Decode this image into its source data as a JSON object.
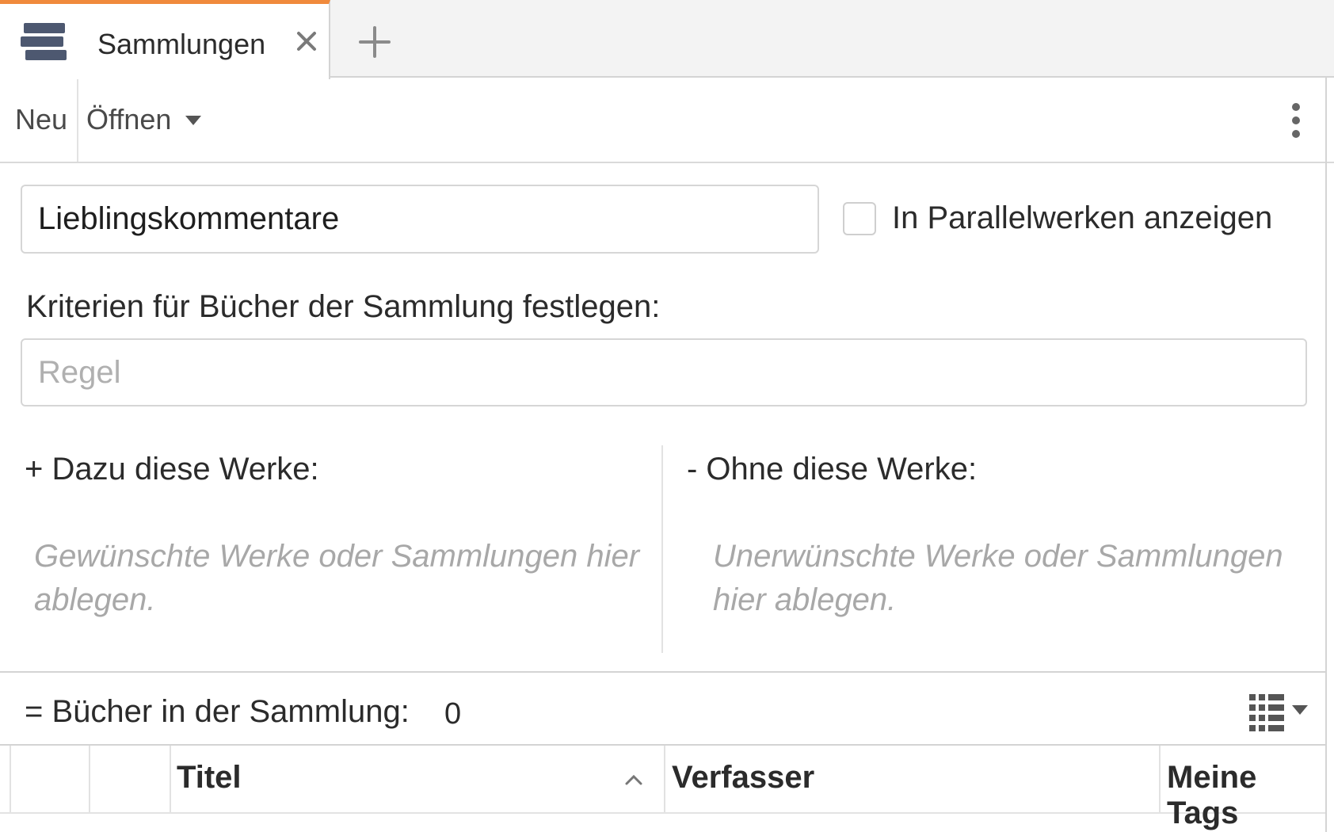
{
  "tabs": [
    {
      "label": "Sammlungen",
      "icon": "books-stack-icon",
      "active": true
    }
  ],
  "tab_add_icon": "plus-icon",
  "tab_close_icon": "close-icon",
  "colors": {
    "accent": "#f08a3c",
    "icon": "#4d5870",
    "border": "#d6d6d6",
    "hint": "#a8a8a8"
  },
  "toolbar": {
    "new_label": "Neu",
    "open_label": "Öffnen",
    "more_icon": "more-vertical-icon"
  },
  "collection": {
    "name_value": "Lieblingskommentare",
    "parallel_label": "In Parallelwerken anzeigen",
    "parallel_checked": false,
    "criteria_label": "Kriterien für Bücher der Sammlung festlegen:",
    "rule_placeholder": "Regel"
  },
  "include": {
    "title": "+ Dazu diese Werke:",
    "hint": "Gewünschte Werke oder Sammlungen hier ablegen."
  },
  "exclude": {
    "title": "- Ohne diese Werke:",
    "hint": "Unerwünschte Werke oder Sammlungen hier ablegen."
  },
  "result": {
    "label": "= Bücher in der Sammlung:",
    "count": "0",
    "view_icon": "list-view-icon"
  },
  "table": {
    "columns": [
      "",
      "",
      "Titel",
      "Verfasser",
      "Meine Tags"
    ],
    "sort_column": "Titel",
    "sort_direction": "ascending"
  }
}
